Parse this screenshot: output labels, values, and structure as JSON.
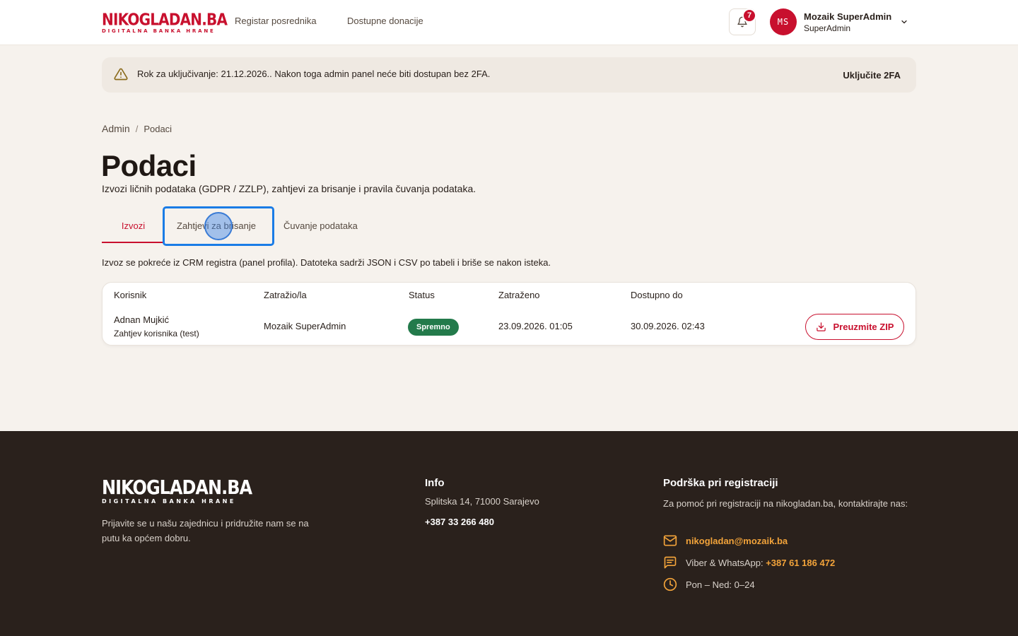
{
  "header": {
    "logo_main": "NIKOGLADAN.BA",
    "logo_sub": "DIGITALNA BANKA HRANE",
    "nav": [
      {
        "label": "Registar posrednika"
      },
      {
        "label": "Dostupne donacije"
      }
    ],
    "notifications_count": "7",
    "user": {
      "initials": "MS",
      "name": "Mozaik SuperAdmin",
      "role": "SuperAdmin"
    }
  },
  "alert": {
    "text": "Rok za uključivanje: 21.12.2026.. Nakon toga admin panel neće biti dostupan bez 2FA.",
    "action_label": "Uključite 2FA"
  },
  "breadcrumb": {
    "root": "Admin",
    "separator": "/",
    "current": "Podaci"
  },
  "page": {
    "title": "Podaci",
    "subtitle": "Izvozi ličnih podataka (GDPR / ZZLP), zahtjevi za brisanje i pravila čuvanja podataka."
  },
  "tabs": [
    {
      "label": "Izvozi",
      "active": true
    },
    {
      "label": "Zahtjevi za brisanje",
      "active": false
    },
    {
      "label": "Čuvanje podataka",
      "active": false
    }
  ],
  "info_line": "Izvoz se pokreće iz CRM registra (panel profila). Datoteka sadrži JSON i CSV po tabeli i briše se nakon isteka.",
  "table": {
    "columns": [
      "Korisnik",
      "Zatražio/la",
      "Status",
      "Zatraženo",
      "Dostupno do"
    ],
    "rows": [
      {
        "user": "Adnan Mujkić",
        "user_note": "Zahtjev korisnika (test)",
        "requested_by": "Mozaik SuperAdmin",
        "status": "Spremno",
        "requested_at": "23.09.2026. 01:05",
        "available_until": "30.09.2026. 02:43",
        "action_label": "Preuzmite ZIP"
      }
    ]
  },
  "footer": {
    "logo_main": "NIKOGLADAN.BA",
    "logo_sub": "DIGITALNA BANKA HRANE",
    "tagline": "Prijavite se u našu zajednicu i pridružite nam se na putu ka općem dobru.",
    "info": {
      "title": "Info",
      "address": "Splitska 14, 71000 Sarajevo",
      "phone": "+387 33 266 480"
    },
    "support": {
      "title": "Podrška pri registraciji",
      "text": "Za pomoć pri registraciji na nikogladan.ba, kontaktirajte nas:",
      "email": "nikogladan@mozaik.ba",
      "messaging_label": "Viber & WhatsApp:",
      "messaging_phone": "+387 61 186 472",
      "hours": "Pon – Ned: 0–24"
    }
  },
  "colors": {
    "brand": "#c8102e",
    "background": "#f6f2ed",
    "footer": "#2a211c",
    "status_ready": "#237a4b",
    "footer_accent": "#f2a33a",
    "focus": "#1a7ce6"
  },
  "icons": [
    "bell-icon",
    "chevron-down-icon",
    "warning-icon",
    "download-icon",
    "mail-icon",
    "chat-icon",
    "clock-icon"
  ]
}
